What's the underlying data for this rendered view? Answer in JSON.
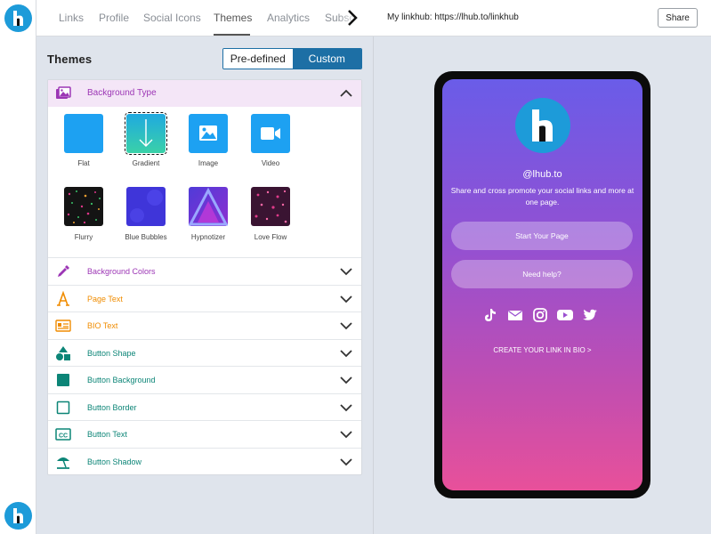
{
  "tabs": [
    "Links",
    "Profile",
    "Social Icons",
    "Themes",
    "Analytics",
    "Subsc"
  ],
  "active_tab": "Themes",
  "themes": {
    "title": "Themes",
    "segment": {
      "predefined": "Pre-defined",
      "custom": "Custom",
      "selected": "Custom"
    }
  },
  "background_type": {
    "label": "Background Type",
    "tiles": [
      {
        "label": "Flat",
        "icon": "square-icon",
        "color": "#1da1f2"
      },
      {
        "label": "Gradient",
        "icon": "arrow-down-icon",
        "color": "#2cc0b8",
        "selected": true
      },
      {
        "label": "Image",
        "icon": "image-icon",
        "color": "#1da1f2"
      },
      {
        "label": "Video",
        "icon": "video-icon",
        "color": "#1da1f2"
      },
      {
        "label": "Flurry",
        "icon": "flurry-pattern",
        "color": "#141414"
      },
      {
        "label": "Blue Bubbles",
        "icon": "bubbles-pattern",
        "color": "#3f35d9"
      },
      {
        "label": "Hypnotizer",
        "icon": "triangle-pattern",
        "color": "#6a2fd2"
      },
      {
        "label": "Love Flow",
        "icon": "hearts-pattern",
        "color": "#3a1432"
      }
    ]
  },
  "sections": [
    {
      "label": "Background Colors",
      "icon": "dropper-icon",
      "color": "#9c36b5"
    },
    {
      "label": "Page Text",
      "icon": "font-icon",
      "color": "#f08c00"
    },
    {
      "label": "BIO Text",
      "icon": "id-card-icon",
      "color": "#f08c00"
    },
    {
      "label": "Button Shape",
      "icon": "shapes-icon",
      "color": "#0c8577"
    },
    {
      "label": "Button Background",
      "icon": "filled-square-icon",
      "color": "#0c8577"
    },
    {
      "label": "Button Border",
      "icon": "outline-square-icon",
      "color": "#0c8577"
    },
    {
      "label": "Button Text",
      "icon": "cc-icon",
      "color": "#0c8577"
    },
    {
      "label": "Button Shadow",
      "icon": "beach-umbrella-icon",
      "color": "#0c8577"
    }
  ],
  "preview": {
    "url_label": "My linkhub: https://lhub.to/linkhub",
    "share": "Share",
    "handle": "@lhub.to",
    "bio": "Share and cross promote your social links and more at one page.",
    "buttons": [
      "Start Your Page",
      "Need help?"
    ],
    "socials": [
      "tiktok-icon",
      "mail-icon",
      "instagram-icon",
      "youtube-icon",
      "twitter-icon"
    ],
    "cta": "CREATE YOUR LINK IN BIO >"
  },
  "colors": {
    "brand": "#1d9bd9",
    "accent": "#1d6fa5",
    "gradient_top": "#6a5ce8",
    "gradient_bottom": "#e8509a"
  }
}
